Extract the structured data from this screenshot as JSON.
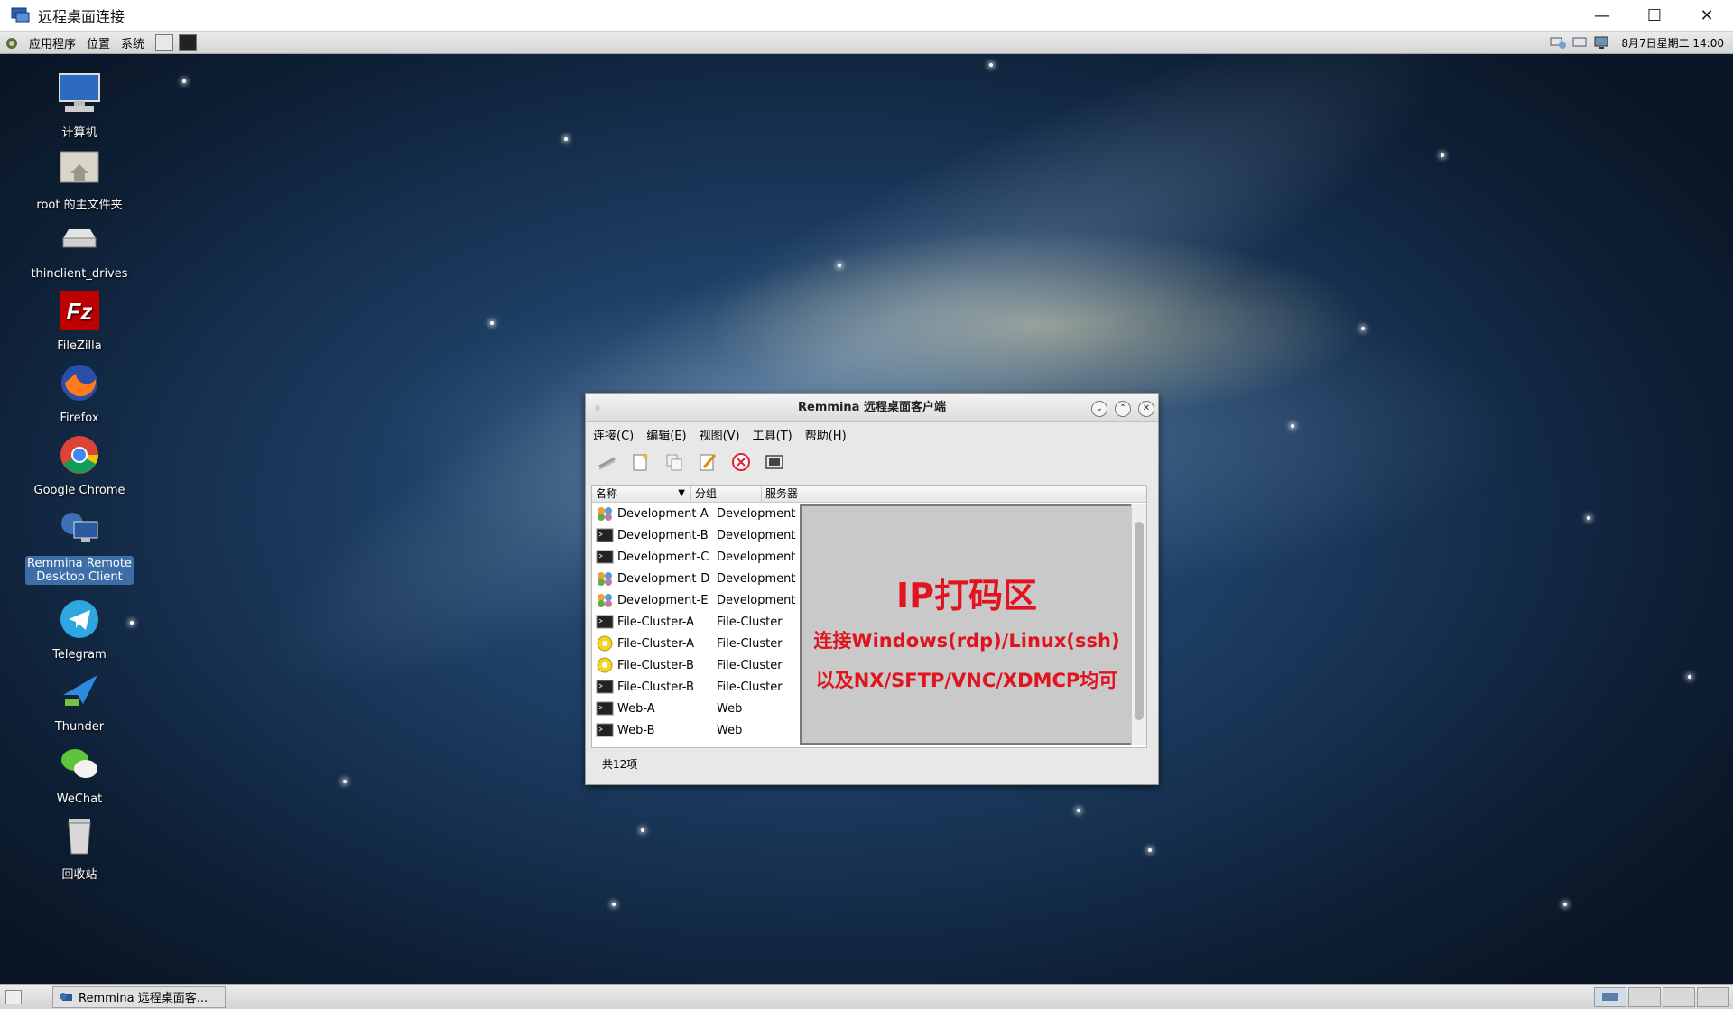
{
  "window": {
    "title": "远程桌面连接",
    "minimize": "—",
    "maximize": "☐",
    "close": "✕"
  },
  "top_panel": {
    "menus": [
      "应用程序",
      "位置",
      "系统"
    ],
    "clock": "8月7日星期二 14:00"
  },
  "desktop_icons": [
    {
      "label": "计算机",
      "icon": "computer-icon"
    },
    {
      "label": "root 的主文件夹",
      "icon": "home-folder-icon"
    },
    {
      "label": "thinclient_drives",
      "icon": "drive-icon"
    },
    {
      "label": "FileZilla",
      "icon": "filezilla-icon"
    },
    {
      "label": "Firefox",
      "icon": "firefox-icon"
    },
    {
      "label": "Google Chrome",
      "icon": "chrome-icon"
    },
    {
      "label": "Remmina Remote Desktop Client",
      "icon": "remmina-icon",
      "selected": true
    },
    {
      "label": "Telegram",
      "icon": "telegram-icon"
    },
    {
      "label": "Thunder",
      "icon": "thunder-icon"
    },
    {
      "label": "WeChat",
      "icon": "wechat-icon"
    },
    {
      "label": "回收站",
      "icon": "trash-icon"
    }
  ],
  "remmina": {
    "title": "Remmina 远程桌面客户端",
    "menus": [
      "连接(C)",
      "编辑(E)",
      "视图(V)",
      "工具(T)",
      "帮助(H)"
    ],
    "columns": [
      "名称",
      "分组",
      "服务器"
    ],
    "rows": [
      {
        "name": "Development-A",
        "group": "Development",
        "type": "rdp"
      },
      {
        "name": "Development-B",
        "group": "Development",
        "type": "ssh"
      },
      {
        "name": "Development-C",
        "group": "Development",
        "type": "ssh"
      },
      {
        "name": "Development-D",
        "group": "Development",
        "type": "rdp"
      },
      {
        "name": "Development-E",
        "group": "Development",
        "type": "rdp"
      },
      {
        "name": "File-Cluster-A",
        "group": "File-Cluster",
        "type": "ssh"
      },
      {
        "name": "File-Cluster-A",
        "group": "File-Cluster",
        "type": "sftp"
      },
      {
        "name": "File-Cluster-B",
        "group": "File-Cluster",
        "type": "sftp"
      },
      {
        "name": "File-Cluster-B",
        "group": "File-Cluster",
        "type": "ssh"
      },
      {
        "name": "Web-A",
        "group": "Web",
        "type": "ssh"
      },
      {
        "name": "Web-B",
        "group": "Web",
        "type": "ssh"
      }
    ],
    "mask": {
      "line1": "IP打码区",
      "line2": "连接Windows(rdp)/Linux(ssh)",
      "line3": "以及NX/SFTP/VNC/XDMCP均可"
    },
    "status": "共12项"
  },
  "taskbar": {
    "task_label": "Remmina 远程桌面客..."
  },
  "colors": {
    "mask_text": "#e0141e",
    "desktop_dark": "#0e2036",
    "selection": "#3e6ea8"
  }
}
